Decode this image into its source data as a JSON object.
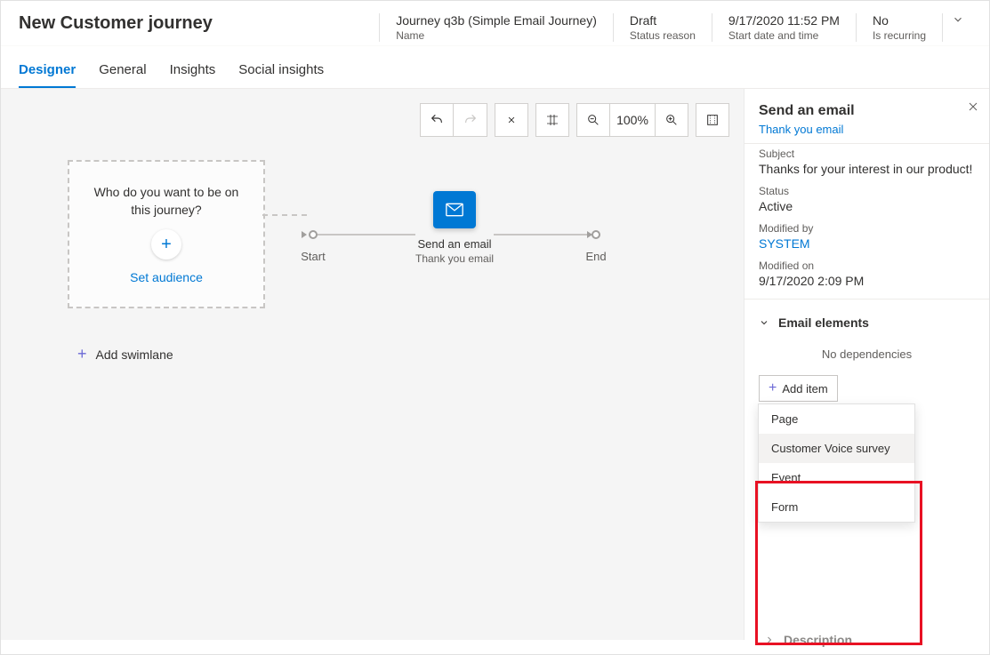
{
  "header": {
    "title": "New Customer journey",
    "meta": [
      {
        "value": "Journey q3b (Simple Email Journey)",
        "label": "Name"
      },
      {
        "value": "Draft",
        "label": "Status reason"
      },
      {
        "value": "9/17/2020 11:52 PM",
        "label": "Start date and time"
      },
      {
        "value": "No",
        "label": "Is recurring"
      }
    ]
  },
  "tabs": [
    "Designer",
    "General",
    "Insights",
    "Social insights"
  ],
  "active_tab": 0,
  "toolbar": {
    "zoom": "100%"
  },
  "audience": {
    "prompt": "Who do you want to be on this journey?",
    "action": "Set audience"
  },
  "flow": {
    "start_label": "Start",
    "end_label": "End",
    "node": {
      "title": "Send an email",
      "subtitle": "Thank you email"
    }
  },
  "add_swimlane": "Add swimlane",
  "panel": {
    "title": "Send an email",
    "subtitle": "Thank you email",
    "fields": {
      "subject_label": "Subject",
      "subject_value": "Thanks for your interest in our product!",
      "status_label": "Status",
      "status_value": "Active",
      "modified_by_label": "Modified by",
      "modified_by_value": "SYSTEM",
      "modified_on_label": "Modified on",
      "modified_on_value": "9/17/2020 2:09 PM"
    },
    "section_elements": "Email elements",
    "no_deps": "No dependencies",
    "add_item": "Add item",
    "dropdown": [
      "Page",
      "Customer Voice survey",
      "Event",
      "Form"
    ],
    "dropdown_hover_index": 1,
    "section_description": "Description"
  }
}
